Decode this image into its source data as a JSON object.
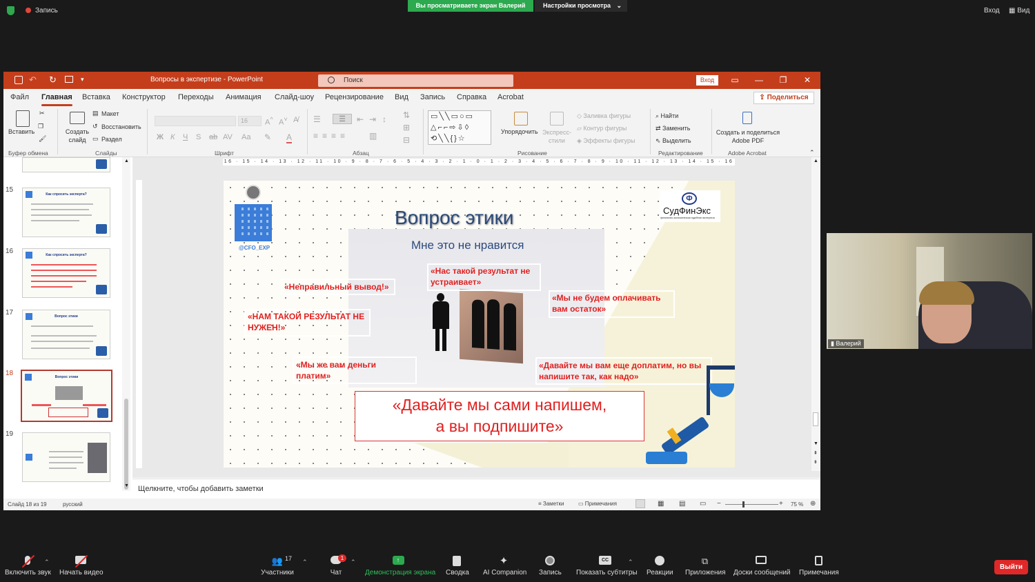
{
  "zoom_top": {
    "recording": "Запись",
    "share_banner": "Вы просматриваете экран Валерий",
    "view_options": "Настройки просмотра",
    "enter": "Вход",
    "view": "Вид"
  },
  "ppt": {
    "title": "Вопросы в экспертизе  -  PowerPoint",
    "search_placeholder": "Поиск",
    "enter": "Вход",
    "tabs": [
      "Файл",
      "Главная",
      "Вставка",
      "Конструктор",
      "Переходы",
      "Анимация",
      "Слайд-шоу",
      "Рецензирование",
      "Вид",
      "Запись",
      "Справка",
      "Acrobat"
    ],
    "share": "Поделиться",
    "ribbon": {
      "paste": "Вставить",
      "clipboard": "Буфер обмена",
      "new_slide": "Создать слайд",
      "layout": "Макет",
      "reset": "Восстановить",
      "section": "Раздел",
      "slides": "Слайды",
      "font_size": "16",
      "font": "Шрифт",
      "paragraph": "Абзац",
      "arrange": "Упорядочить",
      "quick_styles": "Экспресс-стили",
      "shape_fill": "Заливка фигуры",
      "shape_outline": "Контур фигуры",
      "shape_effects": "Эффекты фигуры",
      "drawing": "Рисование",
      "find": "Найти",
      "replace": "Заменить",
      "select": "Выделить",
      "editing": "Редактирование",
      "create_share_pdf": "Создать и поделиться Adobe PDF",
      "adobe": "Adobe Acrobat",
      "format_bold": "Ж",
      "format_italic": "К",
      "format_underline": "Ч",
      "format_strike": "S"
    },
    "thumbnails": [
      {
        "num": "15",
        "title": "Как спросить эксперта?"
      },
      {
        "num": "16",
        "title": "Как спросить эксперта?"
      },
      {
        "num": "17",
        "title": "Вопрос этики"
      },
      {
        "num": "18",
        "title": "Вопрос этики"
      },
      {
        "num": "19",
        "title": ""
      }
    ],
    "ruler": "16 · 15 · 14 · 13 · 12 · 11 · 10 · 9 · 8 · 7 · 6 · 5 · 4 · 3 · 2 · 1 · 0 · 1 · 2 · 3 · 4 · 5 · 6 · 7 · 8 · 9 · 10 · 11 · 12 · 13 · 14 · 15 · 16",
    "notes_placeholder": "Щелкните, чтобы добавить заметки",
    "status": {
      "slide": "Слайд 18 из 19",
      "lang": "русский",
      "notes": "Заметки",
      "comments": "Примечания",
      "zoom": "75 %"
    }
  },
  "slide": {
    "title": "Вопрос этики",
    "subtitle": "Мне это не нравится",
    "qr_caption": "@CFO_EXP",
    "logo_text": "СудФинЭкс",
    "logo_sub": "финансово-экономическая судебная экспертиза",
    "quotes": {
      "q1": "«Неправильный вывод!»",
      "q2": "«Нас такой результат не устраивает»",
      "q3": "«Мы не будем оплачивать вам остаток»",
      "q4": "«НАМ ТАКОЙ РЕЗУЛЬТАТ НЕ НУЖЕН!»",
      "q5": "«Мы же вам деньги платим»",
      "q6": "«Давайте мы вам еще доплатим, но вы напишите так, как надо»"
    },
    "main_quote_1": "«Давайте мы сами напишем,",
    "main_quote_2": "а вы подпишите»"
  },
  "video": {
    "name": "Валерий"
  },
  "bottom": {
    "mute": "Включить звук",
    "video": "Начать видео",
    "participants": "Участники",
    "participants_count": "17",
    "chat": "Чат",
    "chat_badge": "1",
    "share": "Демонстрация экрана",
    "summary": "Сводка",
    "companion": "AI Companion",
    "record": "Запись",
    "captions": "Показать субтитры",
    "reactions": "Реакции",
    "apps": "Приложения",
    "whiteboards": "Доски сообщений",
    "notes": "Примечания",
    "leave": "Выйти"
  },
  "colors": {
    "ppt_accent": "#c43e1c",
    "zoom_green": "#2da94f",
    "slide_red": "#e02020",
    "slide_title": "#2c4a7a"
  }
}
